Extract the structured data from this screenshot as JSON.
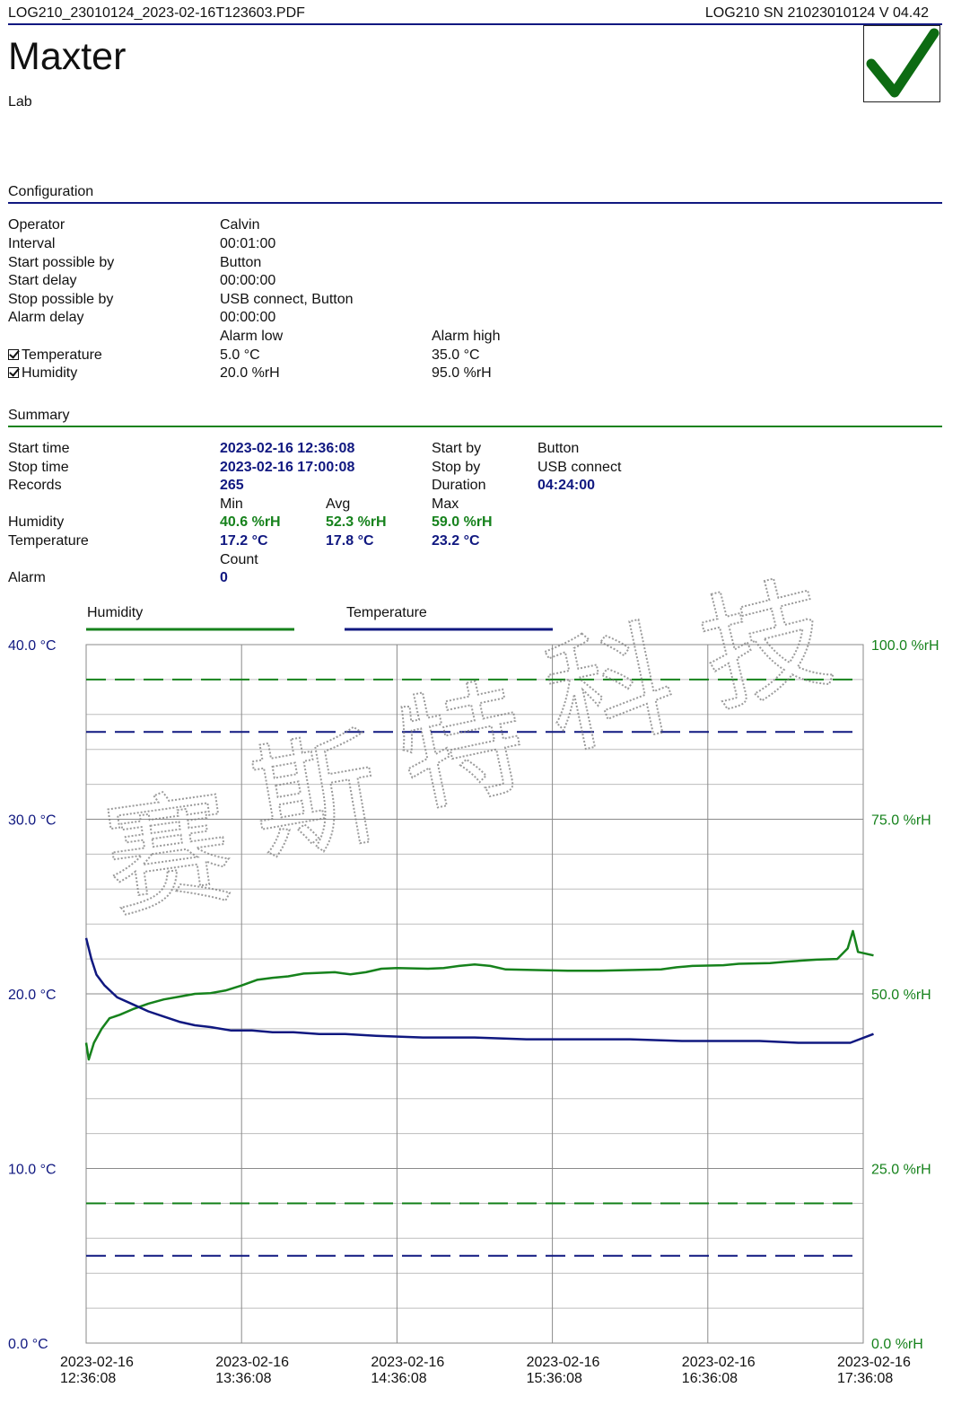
{
  "header": {
    "filename": "LOG210_23010124_2023-02-16T123603.PDF",
    "device_info": "LOG210  SN 21023010124  V 04.42",
    "brand": "Maxter",
    "location": "Lab",
    "status_icon": "check-mark-icon"
  },
  "configuration": {
    "title": "Configuration",
    "rows": [
      {
        "label": "Operator",
        "value": "Calvin"
      },
      {
        "label": "Interval",
        "value": "00:01:00"
      },
      {
        "label": "Start possible by",
        "value": "Button"
      },
      {
        "label": "Start delay",
        "value": "00:00:00"
      },
      {
        "label": "Stop possible by",
        "value": "USB connect,  Button"
      },
      {
        "label": "Alarm delay",
        "value": "00:00:00"
      }
    ],
    "alarm_low_header": "Alarm low",
    "alarm_high_header": "Alarm high",
    "temperature": {
      "label": "Temperature",
      "checked": true,
      "low": "5.0 °C",
      "high": "35.0 °C"
    },
    "humidity": {
      "label": "Humidity",
      "checked": true,
      "low": "20.0 %rH",
      "high": "95.0 %rH"
    }
  },
  "summary": {
    "title": "Summary",
    "start_time_label": "Start time",
    "start_time": "2023-02-16 12:36:08",
    "stop_time_label": "Stop time",
    "stop_time": "2023-02-16 17:00:08",
    "records_label": "Records",
    "records": "265",
    "start_by_label": "Start by",
    "start_by": "Button",
    "stop_by_label": "Stop by",
    "stop_by": "USB connect",
    "duration_label": "Duration",
    "duration": "04:24:00",
    "min_label": "Min",
    "avg_label": "Avg",
    "max_label": "Max",
    "humidity_label": "Humidity",
    "humidity_min": "40.6 %rH",
    "humidity_avg": "52.3 %rH",
    "humidity_max": "59.0 %rH",
    "temperature_label": "Temperature",
    "temperature_min": "17.2 °C",
    "temperature_avg": "17.8 °C",
    "temperature_max": "23.2 °C",
    "count_label": "Count",
    "alarm_label": "Alarm",
    "alarm_count": "0"
  },
  "watermark": {
    "text": "赛斯特科技"
  },
  "colors": {
    "humidity": "#16821c",
    "temperature": "#101880",
    "grid": "#bdbdbd",
    "grid_major": "#8a8a8a"
  },
  "chart_data": {
    "type": "line",
    "legend": [
      "Humidity",
      "Temperature"
    ],
    "x_ticks": [
      [
        "2023-02-16",
        "12:36:08"
      ],
      [
        "2023-02-16",
        "13:36:08"
      ],
      [
        "2023-02-16",
        "14:36:08"
      ],
      [
        "2023-02-16",
        "15:36:08"
      ],
      [
        "2023-02-16",
        "16:36:08"
      ],
      [
        "2023-02-16",
        "17:36:08"
      ]
    ],
    "x_range_minutes": [
      0,
      300
    ],
    "y_left_ticks": [
      "40.0 °C",
      "30.0 °C",
      "20.0 °C",
      "10.0 °C",
      "0.0 °C"
    ],
    "y_left_range": [
      0,
      40
    ],
    "y_right_ticks": [
      "100.0 %rH",
      "75.0 %rH",
      "50.0 %rH",
      "25.0 %rH",
      "0.0 %rH"
    ],
    "y_right_range": [
      0,
      100
    ],
    "alarm_lines": {
      "temperature_low": 5.0,
      "temperature_high": 35.0,
      "humidity_low": 20.0,
      "humidity_high": 95.0
    },
    "series": [
      {
        "name": "Humidity",
        "axis": "right",
        "points": [
          [
            0,
            43
          ],
          [
            1,
            40.6
          ],
          [
            3,
            43
          ],
          [
            6,
            45
          ],
          [
            9,
            46.5
          ],
          [
            13,
            47
          ],
          [
            18,
            47.8
          ],
          [
            24,
            48.6
          ],
          [
            30,
            49.2
          ],
          [
            36,
            49.6
          ],
          [
            42,
            50
          ],
          [
            48,
            50.1
          ],
          [
            54,
            50.5
          ],
          [
            60,
            51.2
          ],
          [
            66,
            52
          ],
          [
            72,
            52.3
          ],
          [
            78,
            52.5
          ],
          [
            84,
            52.9
          ],
          [
            96,
            53.1
          ],
          [
            102,
            52.8
          ],
          [
            108,
            53.1
          ],
          [
            114,
            53.6
          ],
          [
            120,
            53.7
          ],
          [
            132,
            53.6
          ],
          [
            138,
            53.7
          ],
          [
            144,
            54
          ],
          [
            150,
            54.2
          ],
          [
            156,
            54
          ],
          [
            162,
            53.5
          ],
          [
            174,
            53.4
          ],
          [
            186,
            53.3
          ],
          [
            198,
            53.3
          ],
          [
            210,
            53.4
          ],
          [
            222,
            53.5
          ],
          [
            228,
            53.8
          ],
          [
            234,
            54
          ],
          [
            246,
            54.1
          ],
          [
            252,
            54.3
          ],
          [
            264,
            54.4
          ],
          [
            270,
            54.6
          ],
          [
            282,
            54.9
          ],
          [
            290,
            55
          ],
          [
            294,
            56.5
          ],
          [
            296,
            59
          ],
          [
            298,
            56
          ],
          [
            304,
            55.5
          ]
        ]
      },
      {
        "name": "Temperature",
        "axis": "left",
        "points": [
          [
            0,
            23.2
          ],
          [
            2,
            22
          ],
          [
            4,
            21.1
          ],
          [
            7,
            20.5
          ],
          [
            12,
            19.8
          ],
          [
            18,
            19.4
          ],
          [
            24,
            19.0
          ],
          [
            30,
            18.7
          ],
          [
            36,
            18.4
          ],
          [
            42,
            18.2
          ],
          [
            48,
            18.1
          ],
          [
            56,
            17.9
          ],
          [
            64,
            17.9
          ],
          [
            72,
            17.8
          ],
          [
            80,
            17.8
          ],
          [
            90,
            17.7
          ],
          [
            100,
            17.7
          ],
          [
            112,
            17.6
          ],
          [
            130,
            17.5
          ],
          [
            150,
            17.5
          ],
          [
            170,
            17.4
          ],
          [
            190,
            17.4
          ],
          [
            210,
            17.4
          ],
          [
            230,
            17.3
          ],
          [
            260,
            17.3
          ],
          [
            275,
            17.2
          ],
          [
            295,
            17.2
          ],
          [
            304,
            17.7
          ]
        ]
      }
    ]
  }
}
